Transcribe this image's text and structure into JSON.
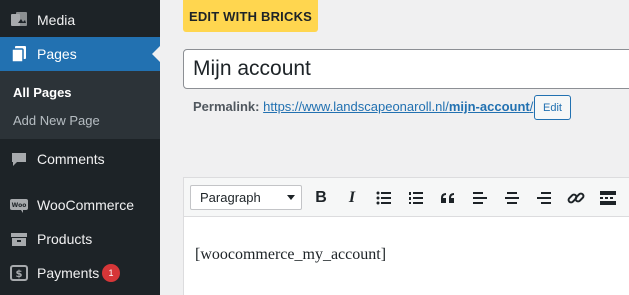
{
  "sidebar": {
    "items": [
      {
        "name": "media",
        "label": "Media",
        "icon": "media-icon"
      },
      {
        "name": "pages",
        "label": "Pages",
        "icon": "pages-icon"
      },
      {
        "name": "comments",
        "label": "Comments",
        "icon": "comments-icon"
      },
      {
        "name": "woocommerce",
        "label": "WooCommerce",
        "icon": "woocommerce-icon"
      },
      {
        "name": "products",
        "label": "Products",
        "icon": "products-icon"
      },
      {
        "name": "payments",
        "label": "Payments",
        "icon": "payments-icon",
        "badge": "1"
      }
    ],
    "submenu": [
      {
        "label": "All Pages"
      },
      {
        "label": "Add New Page"
      }
    ]
  },
  "editor": {
    "bricks_button": "EDIT WITH BRICKS",
    "title_value": "Mijn account",
    "permalink_label": "Permalink:",
    "permalink_base": "https://www.landscapeonaroll.nl/",
    "permalink_slug": "mijn-account",
    "permalink_trailing": "/",
    "edit_button": "Edit",
    "format_select": "Paragraph",
    "content": "[woocommerce_my_account]"
  },
  "toolbar": {
    "buttons": [
      "bold-icon",
      "italic-icon",
      "bullet-list-icon",
      "numbered-list-icon",
      "blockquote-icon",
      "align-left-icon",
      "align-center-icon",
      "align-right-icon",
      "link-icon",
      "read-more-icon"
    ]
  },
  "colors": {
    "sidebar_bg": "#1d2327",
    "accent": "#2271b1",
    "bricks_yellow": "#ffd64f",
    "badge_red": "#d63638"
  }
}
